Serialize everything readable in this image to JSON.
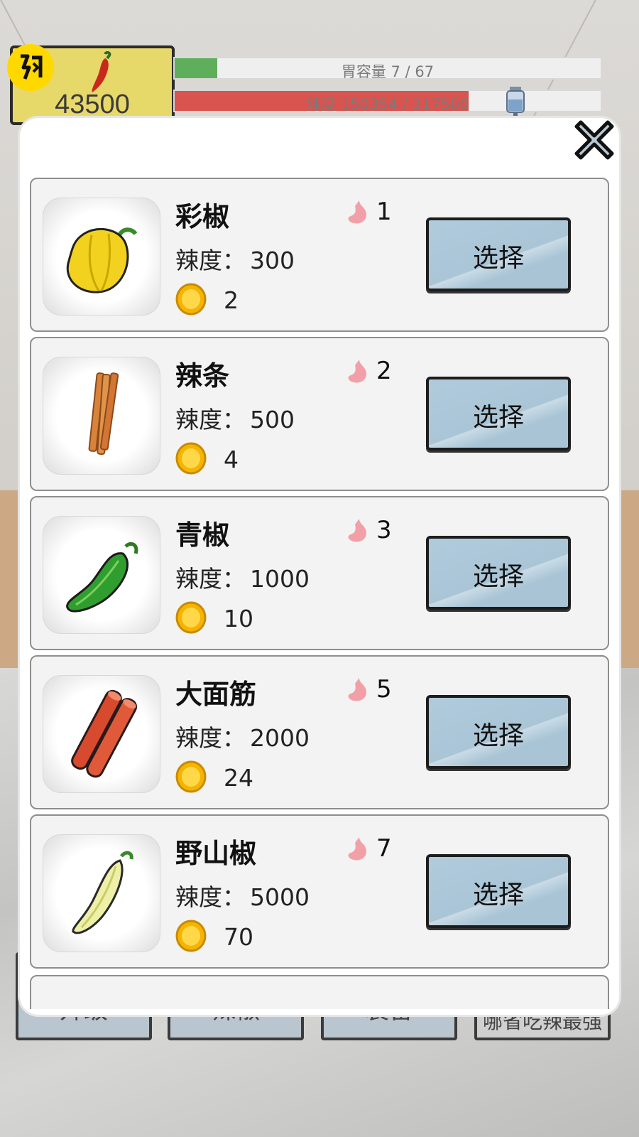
{
  "hud": {
    "money": "43500",
    "stomach_bar": {
      "label": "胃容量 7 / 67",
      "fill_fraction": 0.1
    },
    "spice_bar": {
      "label": "辣度 150354 / 217500",
      "fill_fraction": 0.69
    },
    "badge_icon": "flash-icon",
    "drip_icon": "iv-drip-icon"
  },
  "bottom_menu": [
    {
      "label": "升级"
    },
    {
      "label": "辣椒"
    },
    {
      "label": "装备"
    },
    {
      "label": "哪省吃辣最强"
    }
  ],
  "modal": {
    "close_icon": "close-icon",
    "spice_label": "辣度：",
    "select_label": "选择",
    "items": [
      {
        "name": "彩椒",
        "spice": "300",
        "coins": "2",
        "stomach": "1",
        "icon": "bell-pepper-icon",
        "color": "#f2d21e"
      },
      {
        "name": "辣条",
        "spice": "500",
        "coins": "4",
        "stomach": "2",
        "icon": "spicy-strip-icon",
        "color": "#d9823a"
      },
      {
        "name": "青椒",
        "spice": "1000",
        "coins": "10",
        "stomach": "3",
        "icon": "green-pepper-icon",
        "color": "#2f9e2f"
      },
      {
        "name": "大面筋",
        "spice": "2000",
        "coins": "24",
        "stomach": "5",
        "icon": "gluten-stick-icon",
        "color": "#d84a2e"
      },
      {
        "name": "野山椒",
        "spice": "5000",
        "coins": "70",
        "stomach": "7",
        "icon": "wild-pepper-icon",
        "color": "#eef0a8"
      }
    ]
  },
  "colors": {
    "select_button": "#a9c5d6",
    "coin": "#f5b400",
    "stomach": "#f2a0a8"
  }
}
